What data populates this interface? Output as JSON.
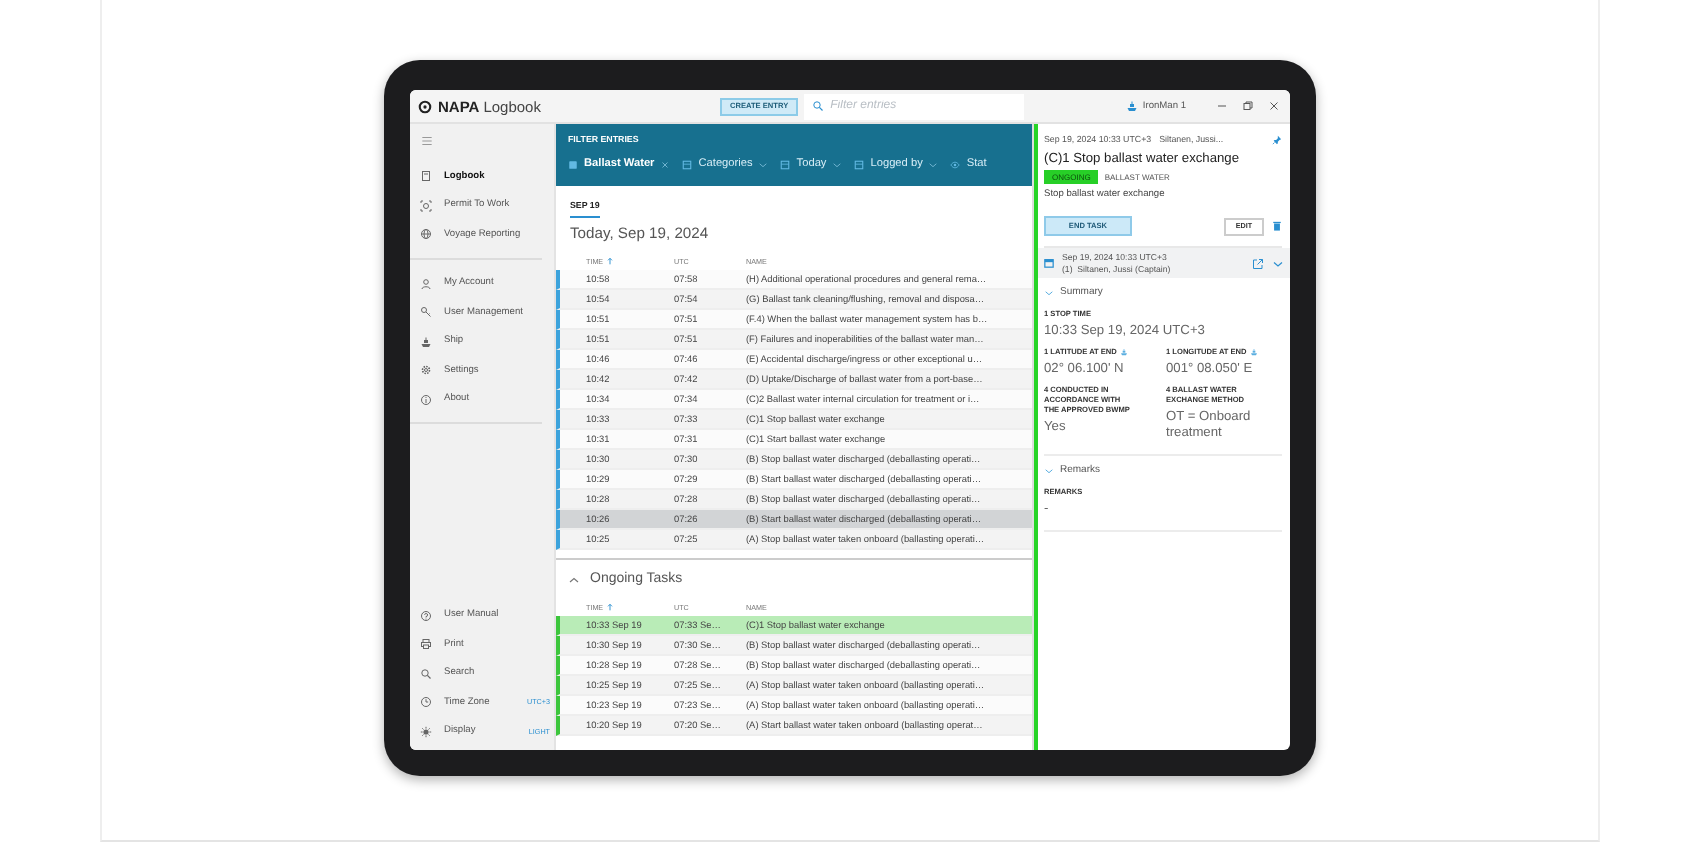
{
  "title_bar": {
    "brand": "NAPA",
    "app_name": "Logbook",
    "create_button": "CREATE ENTRY",
    "search": {
      "placeholder": "Filter entries"
    },
    "vessel": "IronMan 1"
  },
  "sidebar": {
    "groups": [
      [
        {
          "label": "Logbook",
          "selected": true
        },
        {
          "label": "Permit To Work",
          "selected": false
        },
        {
          "label": "Voyage Reporting",
          "selected": false
        }
      ],
      [
        {
          "label": "My Account",
          "selected": false
        },
        {
          "label": "User Management",
          "selected": false
        },
        {
          "label": "Ship",
          "selected": false
        },
        {
          "label": "Settings",
          "selected": false
        },
        {
          "label": "About",
          "selected": false
        }
      ]
    ],
    "bottom_items": [
      {
        "label": "User Manual",
        "selected": false
      },
      {
        "label": "Print",
        "selected": false
      },
      {
        "label": "Search",
        "selected": false
      },
      {
        "label": "Time Zone",
        "value": "UTC+3",
        "selected": false
      },
      {
        "label": "Display",
        "value": "LIGHT",
        "selected": false
      }
    ]
  },
  "filter_panel": {
    "title": "FILTER ENTRIES",
    "chips": [
      {
        "label": "Ballast Water",
        "kind": "active"
      },
      {
        "label": "Categories",
        "kind": "dropdown"
      },
      {
        "label": "Today",
        "kind": "dropdown"
      },
      {
        "label": "Logged by",
        "kind": "dropdown"
      },
      {
        "label": "Stat",
        "kind": "status"
      }
    ]
  },
  "date_tabs": [
    {
      "label": "SEP 19",
      "selected": true
    }
  ],
  "day_heading": "Today, Sep 19, 2024",
  "entries_table": {
    "columns": [
      {
        "label": "TIME",
        "sorted": true
      },
      {
        "label": "UTC",
        "sorted": false
      },
      {
        "label": "NAME",
        "sorted": false
      }
    ],
    "rows": [
      {
        "time": "10:58",
        "utc": "07:58",
        "name": "(H) Additional operational procedures and general rema…",
        "selected": false
      },
      {
        "time": "10:54",
        "utc": "07:54",
        "name": "(G) Ballast tank cleaning/flushing, removal and disposa…",
        "selected": false
      },
      {
        "time": "10:51",
        "utc": "07:51",
        "name": "(F.4) When the ballast water management system has b…",
        "selected": false
      },
      {
        "time": "10:51",
        "utc": "07:51",
        "name": "(F) Failures and inoperabilities of the ballast water man…",
        "selected": false
      },
      {
        "time": "10:46",
        "utc": "07:46",
        "name": "(E) Accidental discharge/ingress or other exceptional u…",
        "selected": false
      },
      {
        "time": "10:42",
        "utc": "07:42",
        "name": "(D) Uptake/Discharge of ballast water from a port-base…",
        "selected": false
      },
      {
        "time": "10:34",
        "utc": "07:34",
        "name": "(C)2 Ballast water internal circulation for treatment or i…",
        "selected": false
      },
      {
        "time": "10:33",
        "utc": "07:33",
        "name": "(C)1 Stop ballast water exchange",
        "selected": false
      },
      {
        "time": "10:31",
        "utc": "07:31",
        "name": "(C)1 Start ballast water exchange",
        "selected": false
      },
      {
        "time": "10:30",
        "utc": "07:30",
        "name": "(B) Stop ballast water discharged (deballasting operati…",
        "selected": false
      },
      {
        "time": "10:29",
        "utc": "07:29",
        "name": "(B) Start ballast water discharged (deballasting operati…",
        "selected": false
      },
      {
        "time": "10:28",
        "utc": "07:28",
        "name": "(B) Stop ballast water discharged (deballasting operati…",
        "selected": false
      },
      {
        "time": "10:26",
        "utc": "07:26",
        "name": "(B) Start ballast water discharged (deballasting operati…",
        "selected": true
      },
      {
        "time": "10:25",
        "utc": "07:25",
        "name": "(A) Stop ballast water taken onboard (ballasting operati…",
        "selected": false
      }
    ]
  },
  "ongoing_tasks": {
    "title": "Ongoing Tasks",
    "expanded": true,
    "columns": [
      {
        "label": "TIME",
        "sorted": true
      },
      {
        "label": "UTC",
        "sorted": false
      },
      {
        "label": "NAME",
        "sorted": false
      }
    ],
    "rows": [
      {
        "time": "10:33 Sep 19",
        "utc": "07:33 Se…",
        "name": "(C)1 Stop ballast water exchange",
        "selected": true
      },
      {
        "time": "10:30 Sep 19",
        "utc": "07:30 Se…",
        "name": "(B) Stop ballast water discharged (deballasting operati…",
        "selected": false
      },
      {
        "time": "10:28 Sep 19",
        "utc": "07:28 Se…",
        "name": "(B) Stop ballast water discharged (deballasting operati…",
        "selected": false
      },
      {
        "time": "10:25 Sep 19",
        "utc": "07:25 Se…",
        "name": "(A) Stop ballast water taken onboard (ballasting operati…",
        "selected": false
      },
      {
        "time": "10:23 Sep 19",
        "utc": "07:23 Se…",
        "name": "(A) Stop ballast water taken onboard (ballasting operati…",
        "selected": false
      },
      {
        "time": "10:20 Sep 19",
        "utc": "07:20 Se…",
        "name": "(A) Start ballast water taken onboard (ballasting operat…",
        "selected": false
      }
    ]
  },
  "detail": {
    "meta_time": "Sep 19, 2024 10:33 UTC+3",
    "meta_author": "Siltanen, Jussi...",
    "pinned": true,
    "title": "(C)1 Stop ballast water exchange",
    "status": "ONGOING",
    "category": "BALLAST WATER",
    "description": "Stop ballast water exchange",
    "end_task_button": "END TASK",
    "edit_button": "EDIT",
    "record": {
      "time": "Sep 19, 2024 10:33 UTC+3",
      "author": "(1)  Siltanen, Jussi (Captain)",
      "expanded": true
    },
    "sections": [
      {
        "title": "Summary",
        "expanded": true,
        "fields": [
          {
            "label": "1 STOP TIME",
            "value": "10:33 Sep 19, 2024 UTC+3",
            "kind": "full",
            "source_icon": false
          },
          {
            "label": "1 LATITUDE AT END",
            "value": "02° 06.100' N",
            "kind": "half",
            "source_icon": true
          },
          {
            "label": "1 LONGITUDE AT END",
            "value": "001° 08.050' E",
            "kind": "half",
            "source_icon": true
          },
          {
            "label": "4 CONDUCTED IN ACCORDANCE WITH THE APPROVED BWMP",
            "value": "Yes",
            "kind": "half",
            "source_icon": false
          },
          {
            "label": "4 BALLAST WATER EXCHANGE METHOD",
            "value": "OT = Onboard treatment",
            "kind": "half",
            "source_icon": false
          }
        ]
      },
      {
        "title": "Remarks",
        "expanded": true,
        "fields": [
          {
            "label": "REMARKS",
            "value": "-",
            "kind": "full",
            "source_icon": false
          }
        ]
      }
    ]
  }
}
